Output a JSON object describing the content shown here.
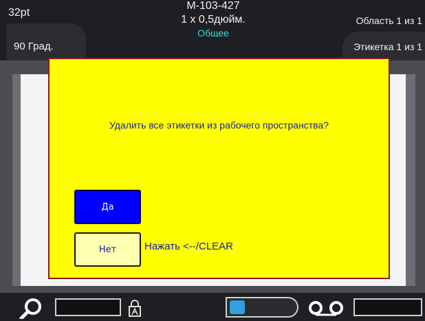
{
  "header": {
    "font_size": "32pt",
    "rotation": "90 Град.",
    "label_part": "M-103-427",
    "label_size": "1 x 0,5дюйм.",
    "mode": "Общее",
    "area": "Область 1 из 1",
    "label": "Этикетка 1 из 1"
  },
  "dialog": {
    "message": "Удалить все этикетки из рабочего пространства?",
    "yes_label": "Да",
    "no_label": "Нет",
    "clear_hint": "Нажать <--/CLEAR"
  },
  "colors": {
    "dialog_bg": "#ffff00",
    "dialog_border": "#8b1b1b",
    "yes_button": "#0000ff",
    "no_button": "#ffffb0",
    "text_blue": "#1a1ab0",
    "accent_cyan": "#27e0e0"
  },
  "bottombar": {
    "icons": [
      "zoom-icon",
      "lock-icon",
      "battery-icon",
      "tape-cassette-icon"
    ]
  }
}
